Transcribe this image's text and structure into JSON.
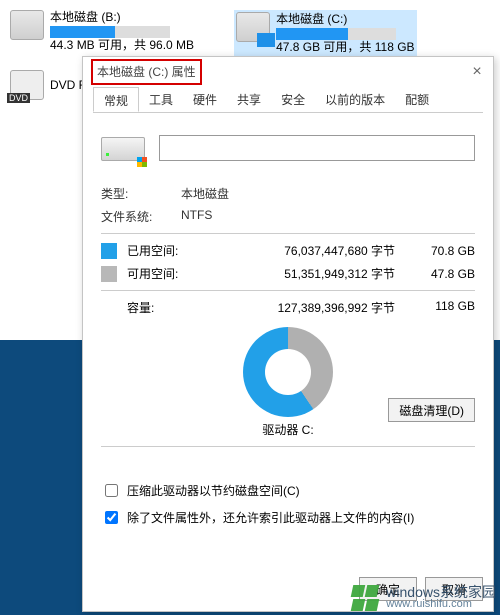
{
  "drives": {
    "b": {
      "name": "本地磁盘 (B:)",
      "info": "44.3 MB 可用，共 96.0 MB",
      "fill": 54
    },
    "c": {
      "name": "本地磁盘 (C:)",
      "info": "47.8 GB 可用，共 118 GB",
      "fill": 60
    }
  },
  "dvd": {
    "tag": "DVD",
    "label": "DVD RW"
  },
  "dialog": {
    "title": "本地磁盘 (C:) 属性",
    "close": "×",
    "tabs": [
      "常规",
      "工具",
      "硬件",
      "共享",
      "安全",
      "以前的版本",
      "配额"
    ],
    "type_label": "类型:",
    "type_value": "本地磁盘",
    "fs_label": "文件系统:",
    "fs_value": "NTFS",
    "used_label": "已用空间:",
    "used_bytes": "76,037,447,680 字节",
    "used_h": "70.8 GB",
    "free_label": "可用空间:",
    "free_bytes": "51,351,949,312 字节",
    "free_h": "47.8 GB",
    "cap_label": "容量:",
    "cap_bytes": "127,389,396,992 字节",
    "cap_h": "118 GB",
    "drv_label": "驱动器 C:",
    "cleanup": "磁盘清理(D)",
    "chk1": "压缩此驱动器以节约磁盘空间(C)",
    "chk2": "除了文件属性外，还允许索引此驱动器上文件的内容(I)",
    "ok": "确定",
    "cancel": "取消"
  },
  "watermark": {
    "t1": "windows系统家园",
    "t2": "www.ruishifu.com"
  }
}
